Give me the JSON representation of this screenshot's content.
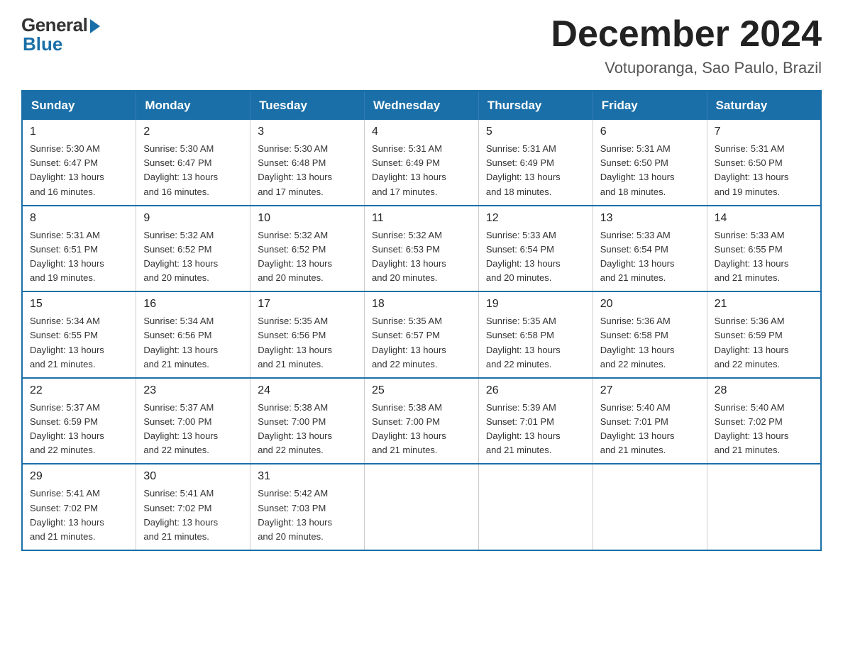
{
  "logo": {
    "general": "General",
    "blue": "Blue"
  },
  "title": "December 2024",
  "location": "Votuporanga, Sao Paulo, Brazil",
  "headers": [
    "Sunday",
    "Monday",
    "Tuesday",
    "Wednesday",
    "Thursday",
    "Friday",
    "Saturday"
  ],
  "weeks": [
    [
      {
        "day": "1",
        "info": "Sunrise: 5:30 AM\nSunset: 6:47 PM\nDaylight: 13 hours\nand 16 minutes."
      },
      {
        "day": "2",
        "info": "Sunrise: 5:30 AM\nSunset: 6:47 PM\nDaylight: 13 hours\nand 16 minutes."
      },
      {
        "day": "3",
        "info": "Sunrise: 5:30 AM\nSunset: 6:48 PM\nDaylight: 13 hours\nand 17 minutes."
      },
      {
        "day": "4",
        "info": "Sunrise: 5:31 AM\nSunset: 6:49 PM\nDaylight: 13 hours\nand 17 minutes."
      },
      {
        "day": "5",
        "info": "Sunrise: 5:31 AM\nSunset: 6:49 PM\nDaylight: 13 hours\nand 18 minutes."
      },
      {
        "day": "6",
        "info": "Sunrise: 5:31 AM\nSunset: 6:50 PM\nDaylight: 13 hours\nand 18 minutes."
      },
      {
        "day": "7",
        "info": "Sunrise: 5:31 AM\nSunset: 6:50 PM\nDaylight: 13 hours\nand 19 minutes."
      }
    ],
    [
      {
        "day": "8",
        "info": "Sunrise: 5:31 AM\nSunset: 6:51 PM\nDaylight: 13 hours\nand 19 minutes."
      },
      {
        "day": "9",
        "info": "Sunrise: 5:32 AM\nSunset: 6:52 PM\nDaylight: 13 hours\nand 20 minutes."
      },
      {
        "day": "10",
        "info": "Sunrise: 5:32 AM\nSunset: 6:52 PM\nDaylight: 13 hours\nand 20 minutes."
      },
      {
        "day": "11",
        "info": "Sunrise: 5:32 AM\nSunset: 6:53 PM\nDaylight: 13 hours\nand 20 minutes."
      },
      {
        "day": "12",
        "info": "Sunrise: 5:33 AM\nSunset: 6:54 PM\nDaylight: 13 hours\nand 20 minutes."
      },
      {
        "day": "13",
        "info": "Sunrise: 5:33 AM\nSunset: 6:54 PM\nDaylight: 13 hours\nand 21 minutes."
      },
      {
        "day": "14",
        "info": "Sunrise: 5:33 AM\nSunset: 6:55 PM\nDaylight: 13 hours\nand 21 minutes."
      }
    ],
    [
      {
        "day": "15",
        "info": "Sunrise: 5:34 AM\nSunset: 6:55 PM\nDaylight: 13 hours\nand 21 minutes."
      },
      {
        "day": "16",
        "info": "Sunrise: 5:34 AM\nSunset: 6:56 PM\nDaylight: 13 hours\nand 21 minutes."
      },
      {
        "day": "17",
        "info": "Sunrise: 5:35 AM\nSunset: 6:56 PM\nDaylight: 13 hours\nand 21 minutes."
      },
      {
        "day": "18",
        "info": "Sunrise: 5:35 AM\nSunset: 6:57 PM\nDaylight: 13 hours\nand 22 minutes."
      },
      {
        "day": "19",
        "info": "Sunrise: 5:35 AM\nSunset: 6:58 PM\nDaylight: 13 hours\nand 22 minutes."
      },
      {
        "day": "20",
        "info": "Sunrise: 5:36 AM\nSunset: 6:58 PM\nDaylight: 13 hours\nand 22 minutes."
      },
      {
        "day": "21",
        "info": "Sunrise: 5:36 AM\nSunset: 6:59 PM\nDaylight: 13 hours\nand 22 minutes."
      }
    ],
    [
      {
        "day": "22",
        "info": "Sunrise: 5:37 AM\nSunset: 6:59 PM\nDaylight: 13 hours\nand 22 minutes."
      },
      {
        "day": "23",
        "info": "Sunrise: 5:37 AM\nSunset: 7:00 PM\nDaylight: 13 hours\nand 22 minutes."
      },
      {
        "day": "24",
        "info": "Sunrise: 5:38 AM\nSunset: 7:00 PM\nDaylight: 13 hours\nand 22 minutes."
      },
      {
        "day": "25",
        "info": "Sunrise: 5:38 AM\nSunset: 7:00 PM\nDaylight: 13 hours\nand 21 minutes."
      },
      {
        "day": "26",
        "info": "Sunrise: 5:39 AM\nSunset: 7:01 PM\nDaylight: 13 hours\nand 21 minutes."
      },
      {
        "day": "27",
        "info": "Sunrise: 5:40 AM\nSunset: 7:01 PM\nDaylight: 13 hours\nand 21 minutes."
      },
      {
        "day": "28",
        "info": "Sunrise: 5:40 AM\nSunset: 7:02 PM\nDaylight: 13 hours\nand 21 minutes."
      }
    ],
    [
      {
        "day": "29",
        "info": "Sunrise: 5:41 AM\nSunset: 7:02 PM\nDaylight: 13 hours\nand 21 minutes."
      },
      {
        "day": "30",
        "info": "Sunrise: 5:41 AM\nSunset: 7:02 PM\nDaylight: 13 hours\nand 21 minutes."
      },
      {
        "day": "31",
        "info": "Sunrise: 5:42 AM\nSunset: 7:03 PM\nDaylight: 13 hours\nand 20 minutes."
      },
      null,
      null,
      null,
      null
    ]
  ]
}
